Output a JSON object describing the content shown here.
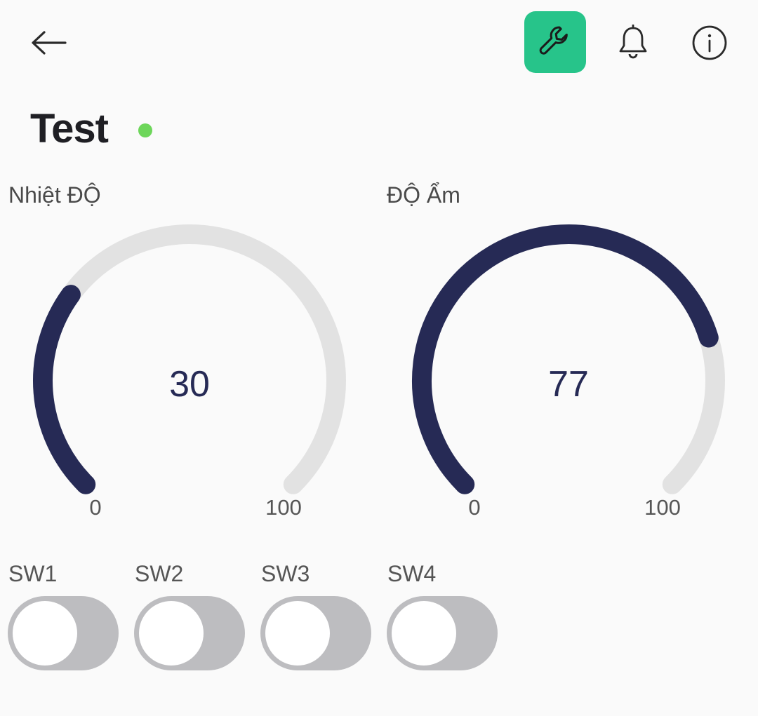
{
  "header": {
    "back_icon": "arrow-left-icon",
    "tool_icon": "wrench-icon",
    "tool_accent": "#27c48a",
    "bell_icon": "bell-icon",
    "info_icon": "info-icon"
  },
  "device": {
    "title": "Test",
    "status": "online",
    "status_color": "#6dd65a"
  },
  "gauges": [
    {
      "label": "Nhiệt ĐỘ",
      "value": "30",
      "min": "0",
      "max": "100",
      "level": 30
    },
    {
      "label": "ĐỘ Ẩm",
      "value": "77",
      "min": "0",
      "max": "100",
      "level": 77
    }
  ],
  "switches": [
    {
      "label": "SW1",
      "on": false
    },
    {
      "label": "SW2",
      "on": false
    },
    {
      "label": "SW3",
      "on": false
    },
    {
      "label": "SW4",
      "on": false
    }
  ],
  "colors": {
    "gauge_fill": "#262a55",
    "gauge_track": "#e2e2e2",
    "switch_off": "#bdbdc0"
  }
}
